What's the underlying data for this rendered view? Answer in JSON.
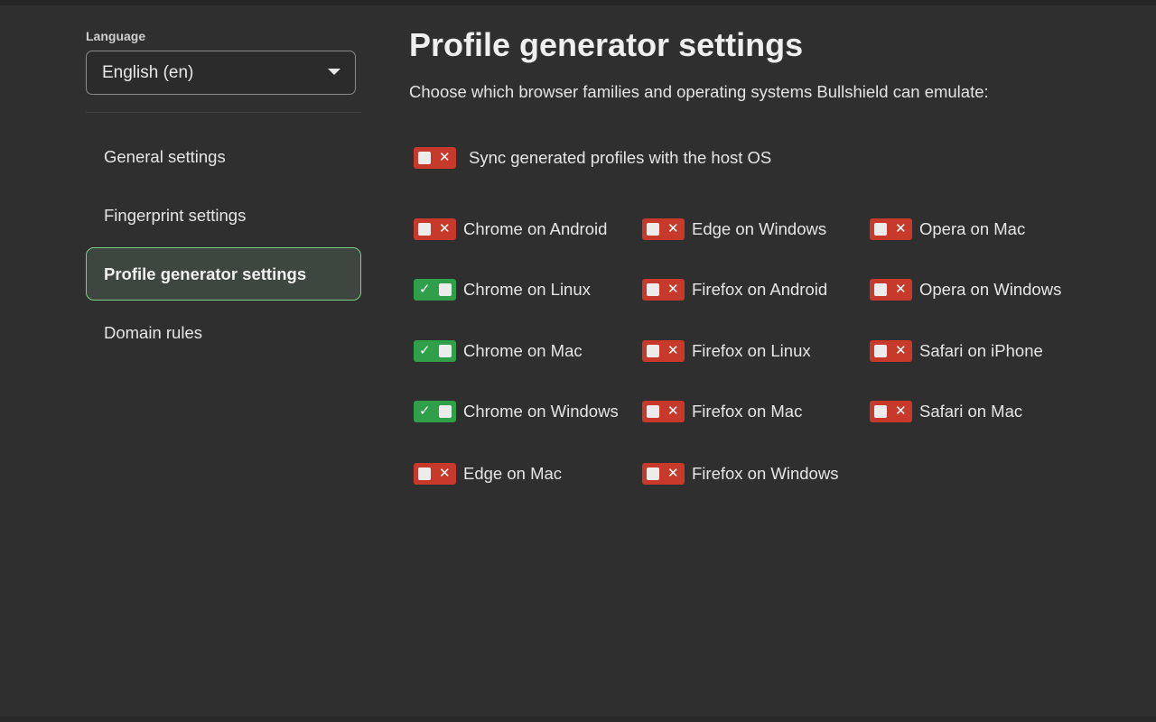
{
  "sidebar": {
    "language_label": "Language",
    "language_value": "English (en)",
    "nav": [
      {
        "label": "General settings",
        "active": false
      },
      {
        "label": "Fingerprint settings",
        "active": false
      },
      {
        "label": "Profile generator settings",
        "active": true
      },
      {
        "label": "Domain rules",
        "active": false
      }
    ]
  },
  "main": {
    "title": "Profile generator settings",
    "subtitle": "Choose which browser families and operating systems Bullshield can emulate:",
    "sync": {
      "label": "Sync generated profiles with the host OS",
      "enabled": false
    },
    "columns": [
      [
        {
          "label": "Chrome on Android",
          "enabled": false
        },
        {
          "label": "Chrome on Linux",
          "enabled": true
        },
        {
          "label": "Chrome on Mac",
          "enabled": true
        },
        {
          "label": "Chrome on Windows",
          "enabled": true
        },
        {
          "label": "Edge on Mac",
          "enabled": false
        }
      ],
      [
        {
          "label": "Edge on Windows",
          "enabled": false
        },
        {
          "label": "Firefox on Android",
          "enabled": false
        },
        {
          "label": "Firefox on Linux",
          "enabled": false
        },
        {
          "label": "Firefox on Mac",
          "enabled": false
        },
        {
          "label": "Firefox on Windows",
          "enabled": false
        }
      ],
      [
        {
          "label": "Opera on Mac",
          "enabled": false
        },
        {
          "label": "Opera on Windows",
          "enabled": false
        },
        {
          "label": "Safari on iPhone",
          "enabled": false
        },
        {
          "label": "Safari on Mac",
          "enabled": false
        }
      ]
    ]
  },
  "icons": {
    "off_mark": "✕",
    "on_mark": "✓",
    "caret": "chevron-down-icon"
  },
  "colors": {
    "background": "#2f2f2f",
    "toggle_off": "#c73a2b",
    "toggle_on": "#2fa049",
    "active_nav_border": "#7bd088",
    "active_nav_bg": "#3d463f"
  }
}
